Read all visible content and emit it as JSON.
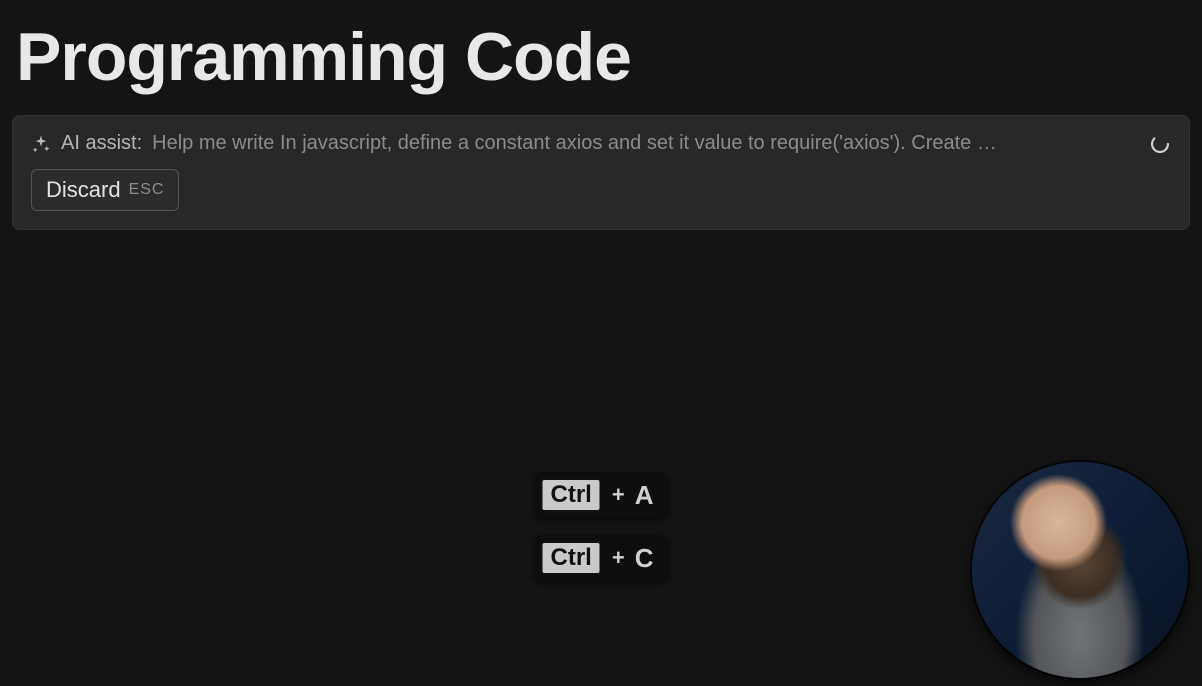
{
  "header": {
    "title": "Programming Code"
  },
  "assist": {
    "label": "AI assist:",
    "prompt_text": "Help me write In javascript, define a constant axios and set it value to require('axios'). Create …",
    "discard_label": "Discard",
    "discard_hint": "ESC"
  },
  "shortcuts": [
    {
      "modifier": "Ctrl",
      "sep": "+",
      "key": "A"
    },
    {
      "modifier": "Ctrl",
      "sep": "+",
      "key": "C"
    }
  ]
}
